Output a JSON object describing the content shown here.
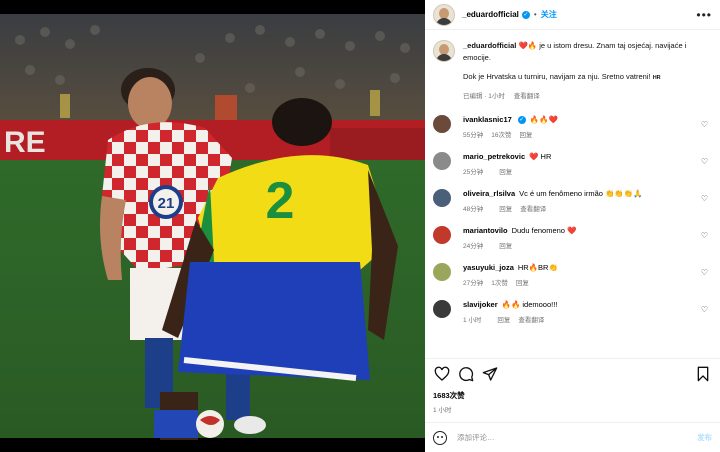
{
  "post": {
    "username": "_eduardofficial",
    "follow_label": "关注",
    "separator": "•",
    "more_icon": "ellipsis-icon",
    "caption_line1": "je u istom dresu. Znam taj osjećaj. navijaće i emocije.",
    "caption_emojis": "❤️🔥",
    "caption_line2": "Dok je Hrvatska u turniru, navijam za nju. Sretno vatreni!",
    "caption_flag": "HR",
    "caption_time": "已编辑 · 1小时",
    "translate_label": "查看翻译",
    "likes": "1683次赞",
    "time_ago": "1 小时",
    "comment_placeholder": "添加评论…",
    "post_button": "发布"
  },
  "comments": [
    {
      "username": "ivanklasnic17",
      "text": "🔥🔥❤️",
      "time": "55分钟",
      "likes": "16次赞",
      "reply": "回复",
      "translate": "",
      "verified": true,
      "avatar_color": "#6b4a3a"
    },
    {
      "username": "mario_petrekovic",
      "text": "❤️ HR",
      "time": "25分钟",
      "likes": "",
      "reply": "回复",
      "translate": "",
      "verified": false,
      "avatar_color": "#8a8a8a"
    },
    {
      "username": "oliveira_rlsilva",
      "text": "Vc é um fenômeno irmão 👏👏👏🙏",
      "time": "48分钟",
      "likes": "",
      "reply": "回复",
      "translate": "查看翻译",
      "verified": false,
      "avatar_color": "#4a5f78"
    },
    {
      "username": "mariantovilo",
      "text": "Dudu fenomeno ❤️",
      "time": "24分钟",
      "likes": "",
      "reply": "回复",
      "translate": "",
      "verified": false,
      "avatar_color": "#c0392b"
    },
    {
      "username": "yasuyuki_joza",
      "text": "HR🔥BR👏",
      "time": "27分钟",
      "likes": "1次赞",
      "reply": "回复",
      "translate": "",
      "verified": false,
      "avatar_color": "#9aa65c"
    },
    {
      "username": "slavijoker",
      "text": "🔥🔥 idemooo!!!",
      "time": "1 小时",
      "likes": "",
      "reply": "回复",
      "translate": "查看翻译",
      "verified": false,
      "avatar_color": "#3a3a3a"
    }
  ],
  "photo": {
    "jersey_number_croatia": "21",
    "jersey_number_brazil": "2",
    "ad_board_text": "RE"
  }
}
